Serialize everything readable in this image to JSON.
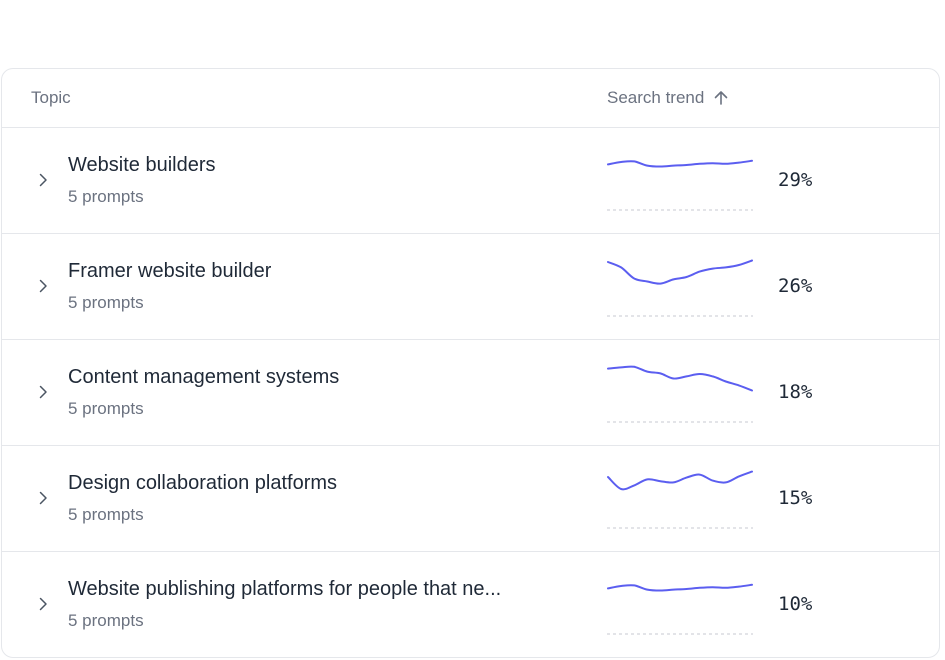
{
  "table": {
    "columns": {
      "topic": "Topic",
      "search_trend": "Search trend"
    },
    "sort": {
      "column": "search_trend",
      "direction": "ascending-arrow-up"
    },
    "accent_color": "#5b5ef0",
    "baseline_color": "#c7cad1",
    "rows": [
      {
        "title": "Website builders",
        "subtitle": "5 prompts",
        "percent": "29%",
        "trend": [
          0.62,
          0.7,
          0.72,
          0.58,
          0.55,
          0.58,
          0.6,
          0.64,
          0.66,
          0.64,
          0.68,
          0.74
        ]
      },
      {
        "title": "Framer website builder",
        "subtitle": "5 prompts",
        "percent": "26%",
        "trend": [
          0.9,
          0.72,
          0.35,
          0.25,
          0.18,
          0.32,
          0.4,
          0.58,
          0.68,
          0.72,
          0.8,
          0.95
        ]
      },
      {
        "title": "Content management systems",
        "subtitle": "5 prompts",
        "percent": "18%",
        "trend": [
          0.88,
          0.92,
          0.94,
          0.78,
          0.72,
          0.55,
          0.62,
          0.7,
          0.62,
          0.45,
          0.32,
          0.15
        ]
      },
      {
        "title": "Design collaboration platforms",
        "subtitle": "5 prompts",
        "percent": "15%",
        "trend": [
          0.8,
          0.4,
          0.52,
          0.72,
          0.66,
          0.62,
          0.78,
          0.88,
          0.68,
          0.62,
          0.82,
          0.98
        ]
      },
      {
        "title": "Website publishing platforms for people that ne...",
        "subtitle": "5 prompts",
        "percent": "10%",
        "trend": [
          0.62,
          0.7,
          0.72,
          0.58,
          0.55,
          0.58,
          0.6,
          0.64,
          0.66,
          0.64,
          0.68,
          0.74
        ]
      }
    ]
  }
}
